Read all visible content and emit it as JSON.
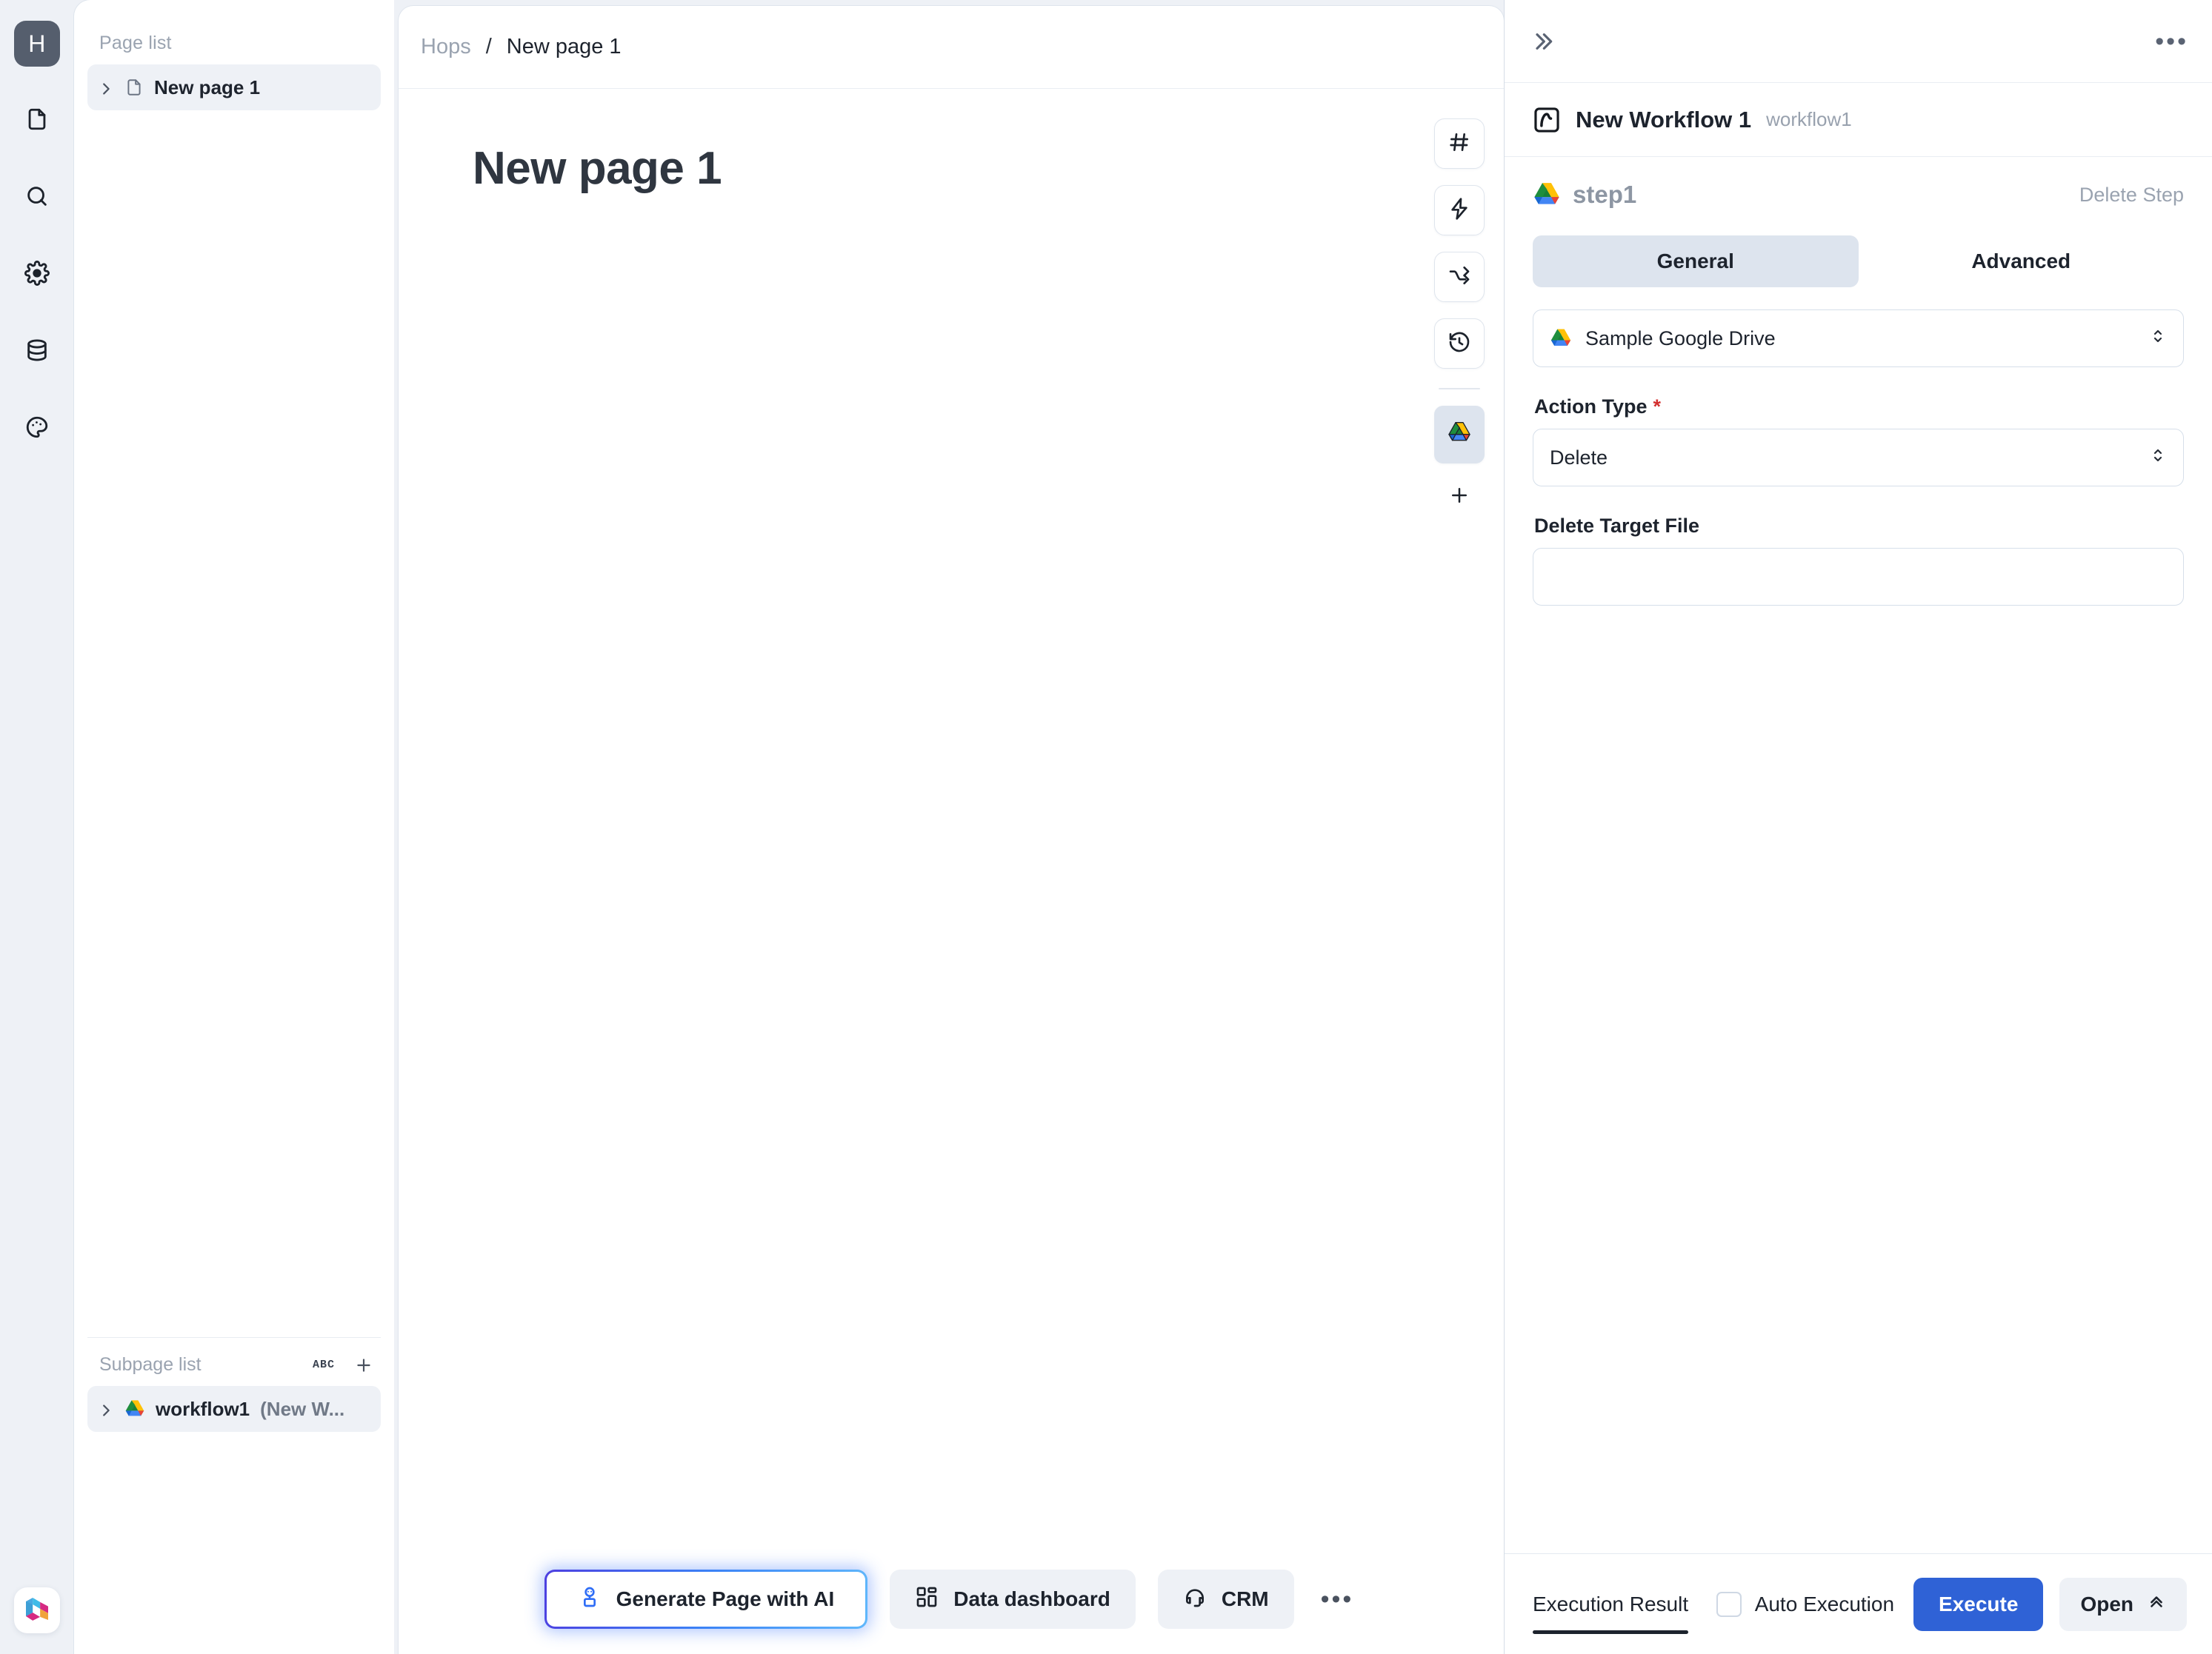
{
  "rail": {
    "avatar_letter": "H",
    "icons": [
      {
        "name": "document-icon",
        "label": "Pages"
      },
      {
        "name": "search-icon",
        "label": "Search"
      },
      {
        "name": "gear-icon",
        "label": "Settings"
      },
      {
        "name": "database-icon",
        "label": "Data"
      },
      {
        "name": "palette-icon",
        "label": "Theme"
      }
    ],
    "brand_logo": "hops-logo"
  },
  "page_list": {
    "header": "Page list",
    "items": [
      {
        "label": "New page 1",
        "icon": "document-icon",
        "selected": true
      }
    ],
    "subpage": {
      "header": "Subpage list",
      "sort_label": "ABC",
      "add_label": "+",
      "items": [
        {
          "label": "workflow1 ",
          "suffix": "(New W...",
          "icon": "google-drive-icon",
          "selected": true
        }
      ]
    }
  },
  "breadcrumb": {
    "root": "Hops",
    "separator": "/",
    "current": "New page 1"
  },
  "canvas": {
    "page_title": "New page 1",
    "tools": [
      {
        "name": "hash-icon",
        "label": "Variables"
      },
      {
        "name": "lightning-icon",
        "label": "Actions"
      },
      {
        "name": "shuffle-icon",
        "label": "Branch"
      },
      {
        "name": "history-icon",
        "label": "History"
      },
      {
        "name": "google-drive-icon",
        "label": "Google Drive",
        "selected": true
      }
    ],
    "add_tool_label": "+"
  },
  "bottom_bar": {
    "buttons": [
      {
        "label": "Generate Page with AI",
        "icon": "robot-icon",
        "highlighted": true
      },
      {
        "label": "Data dashboard",
        "icon": "dashboard-icon",
        "highlighted": false
      },
      {
        "label": "CRM",
        "icon": "headset-icon",
        "highlighted": false
      }
    ],
    "more_label": "•••"
  },
  "right_panel": {
    "collapse_label": "»",
    "more_label": "•••",
    "workflow": {
      "icon": "workflow-icon",
      "name": "New Workflow 1",
      "id": "workflow1"
    },
    "step": {
      "icon": "google-drive-icon",
      "name": "step1",
      "delete_label": "Delete Step"
    },
    "tabs": [
      {
        "label": "General",
        "active": true
      },
      {
        "label": "Advanced",
        "active": false
      }
    ],
    "fields": {
      "connection": {
        "icon": "google-drive-icon",
        "value": "Sample Google Drive"
      },
      "action_type": {
        "label": "Action Type",
        "required_marker": "*",
        "value": "Delete"
      },
      "delete_target_file": {
        "label": "Delete Target File",
        "value": "",
        "placeholder": ""
      }
    },
    "footer": {
      "result_tab": "Execution Result",
      "auto_execution_label": "Auto Execution",
      "auto_execution_checked": false,
      "execute_label": "Execute",
      "open_label": "Open"
    }
  },
  "colors": {
    "accent_blue": "#2f62d6",
    "panel_bg": "#ffffff",
    "app_bg": "#eef1f6",
    "selected_chip": "#dde4ee",
    "required_red": "#d3302f",
    "muted_text": "#9aa3b0"
  }
}
